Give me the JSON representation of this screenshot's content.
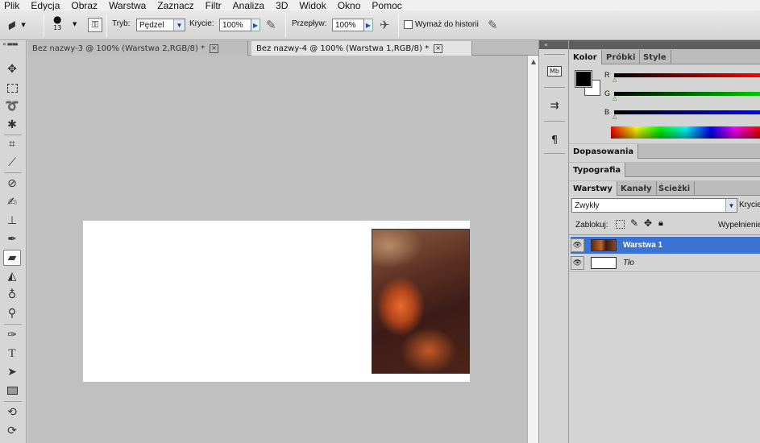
{
  "menu": [
    "Plik",
    "Edycja",
    "Obraz",
    "Warstwa",
    "Zaznacz",
    "Filtr",
    "Analiza",
    "3D",
    "Widok",
    "Okno",
    "Pomoc"
  ],
  "options": {
    "brush_size": "13",
    "mode_label": "Tryb:",
    "mode_value": "Pędzel",
    "opacity_label": "Krycie:",
    "opacity_value": "100%",
    "flow_label": "Przepływ:",
    "flow_value": "100%",
    "erase_history_label": "Wymaż do historii"
  },
  "tabs": [
    {
      "label": "Bez nazwy-3 @ 100% (Warstwa 2,RGB/8) *",
      "close": "×"
    },
    {
      "label": "Bez nazwy-4 @ 100% (Warstwa 1,RGB/8) *",
      "close": "×"
    }
  ],
  "dock_icons": [
    {
      "name": "mini-bridge-icon",
      "glyph": "Mb"
    },
    {
      "name": "clone-source-icon",
      "glyph": "⇉"
    },
    {
      "name": "paragraph-icon",
      "glyph": "¶"
    }
  ],
  "color_panel": {
    "tabs": [
      "Kolor",
      "Próbki",
      "Style"
    ],
    "channels": [
      "R",
      "G",
      "B"
    ],
    "fg_color": "#000000",
    "bg_color": "#ffffff"
  },
  "adjustments_panel": {
    "tab": "Dopasowania"
  },
  "typography_panel": {
    "tab": "Typografia"
  },
  "layers_panel": {
    "tabs": [
      "Warstwy",
      "Kanały",
      "Ścieżki"
    ],
    "blend_mode": "Zwykły",
    "opacity_label": "Krycie",
    "lock_label": "Zablokuj:",
    "fill_label": "Wypełnienie",
    "layers": [
      {
        "name": "Warstwa 1",
        "selected": true
      },
      {
        "name": "Tło",
        "selected": false
      }
    ]
  },
  "colors": {
    "selection": "#3a73d4",
    "panel_bg": "#d4d4d4",
    "canvas_bg": "#c0c0c0"
  }
}
